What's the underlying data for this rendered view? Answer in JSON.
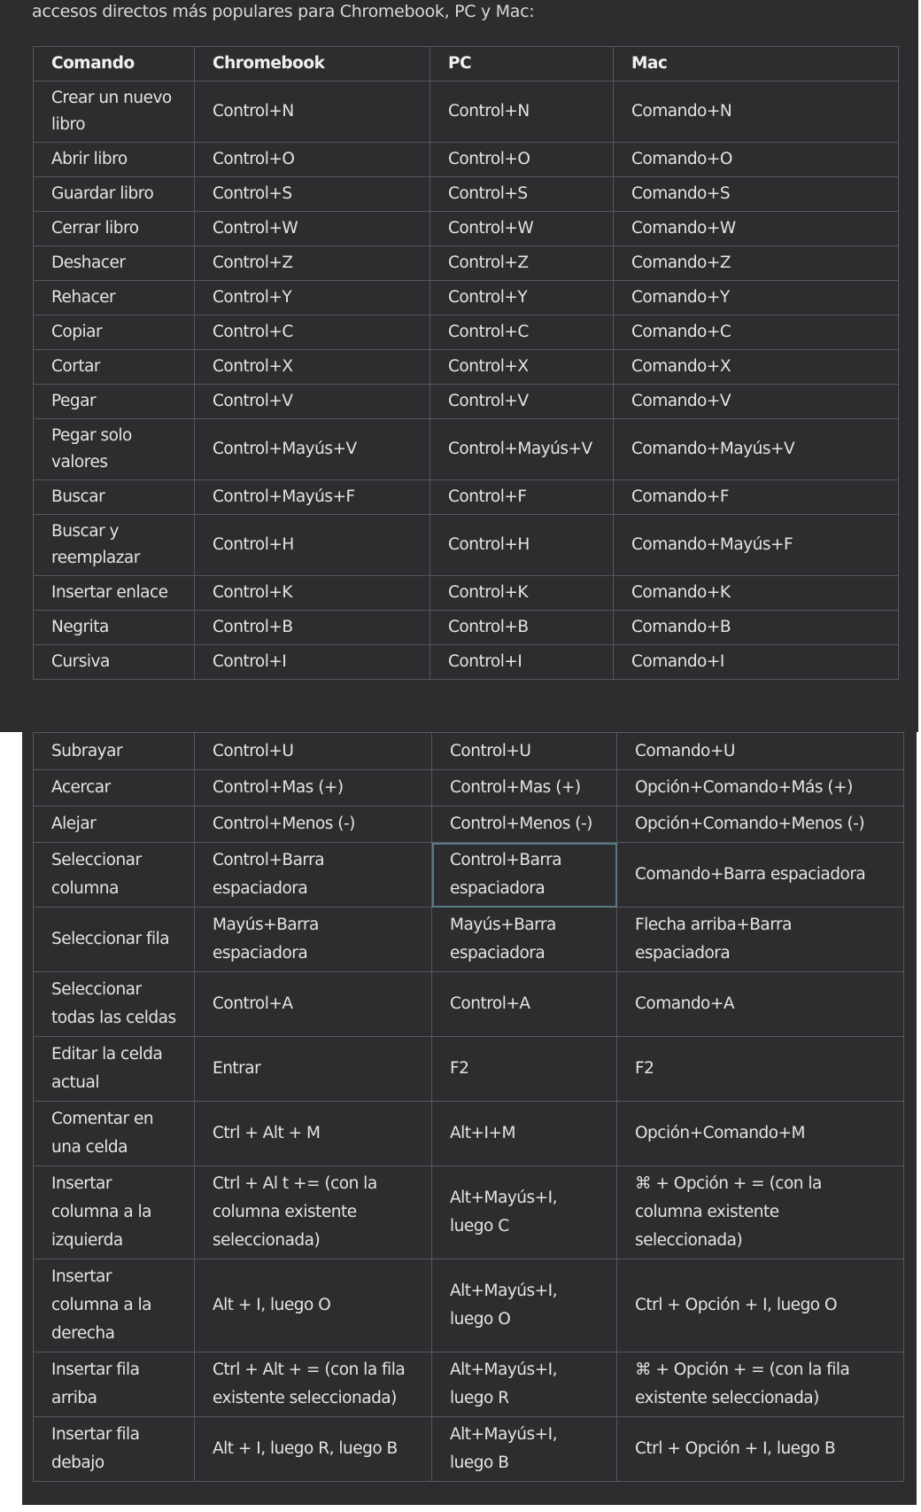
{
  "intro_text": "accesos directos más populares para Chromebook, PC y Mac:",
  "columns": [
    "Comando",
    "Chromebook",
    "PC",
    "Mac"
  ],
  "rows_top": [
    [
      "Crear un nuevo libro",
      "Control+N",
      "Control+N",
      "Comando+N"
    ],
    [
      "Abrir libro",
      "Control+O",
      "Control+O",
      "Comando+O"
    ],
    [
      "Guardar libro",
      "Control+S",
      "Control+S",
      "Comando+S"
    ],
    [
      "Cerrar libro",
      "Control+W",
      "Control+W",
      "Comando+W"
    ],
    [
      "Deshacer",
      "Control+Z",
      "Control+Z",
      "Comando+Z"
    ],
    [
      "Rehacer",
      "Control+Y",
      "Control+Y",
      "Comando+Y"
    ],
    [
      "Copiar",
      "Control+C",
      "Control+C",
      "Comando+C"
    ],
    [
      "Cortar",
      "Control+X",
      "Control+X",
      "Comando+X"
    ],
    [
      "Pegar",
      "Control+V",
      "Control+V",
      "Comando+V"
    ],
    [
      "Pegar solo valores",
      "Control+Mayús+V",
      "Control+Mayús+V",
      "Comando+Mayús+V"
    ],
    [
      "Buscar",
      "Control+Mayús+F",
      "Control+F",
      "Comando+F"
    ],
    [
      "Buscar y reemplazar",
      "Control+H",
      "Control+H",
      "Comando+Mayús+F"
    ],
    [
      "Insertar enlace",
      "Control+K",
      "Control+K",
      "Comando+K"
    ],
    [
      "Negrita",
      "Control+B",
      "Control+B",
      "Comando+B"
    ],
    [
      "Cursiva",
      "Control+I",
      "Control+I",
      "Comando+I"
    ]
  ],
  "rows_bottom": [
    [
      "Subrayar",
      "Control+U",
      "Control+U",
      "Comando+U"
    ],
    [
      "Acercar",
      "Control+Mas (+)",
      "Control+Mas (+)",
      "Opción+Comando+Más (+)"
    ],
    [
      "Alejar",
      "Control+Menos (-)",
      "Control+Menos (-)",
      "Opción+Comando+Menos (-)"
    ],
    [
      "Seleccionar columna",
      "Control+Barra espaciadora",
      "Control+Barra espaciadora",
      "Comando+Barra espaciadora"
    ],
    [
      "Seleccionar fila",
      "Mayús+Barra espaciadora",
      "Mayús+Barra espaciadora",
      "Flecha arriba+Barra espaciadora"
    ],
    [
      "Seleccionar todas las celdas",
      "Control+A",
      "Control+A",
      "Comando+A"
    ],
    [
      "Editar la celda actual",
      "Entrar",
      "F2",
      "F2"
    ],
    [
      "Comentar en una celda",
      "Ctrl + Alt + M",
      "Alt+I+M",
      "Opción+Comando+M"
    ],
    [
      "Insertar columna a la izquierda",
      "Ctrl + Al t += (con la columna existente seleccionada)",
      "Alt+Mayús+I, luego C",
      "⌘ + Opción + = (con la columna existente seleccionada)"
    ],
    [
      "Insertar columna a la derecha",
      "Alt + I, luego O",
      "Alt+Mayús+I, luego O",
      "Ctrl + Opción + I, luego O"
    ],
    [
      "Insertar fila arriba",
      "Ctrl + Alt + = (con la fila existente seleccionada)",
      "Alt+Mayús+I, luego R",
      "⌘ + Opción + = (con la fila existente seleccionada)"
    ],
    [
      "Insertar fila debajo",
      "Alt + I, luego R, luego B",
      "Alt+Mayús+I, luego B",
      "Ctrl + Opción + I, luego B"
    ]
  ],
  "colors": {
    "background": "#2d2d2f",
    "border": "#55575b",
    "text": "#e4e4e4",
    "focus_border": "#5a7b86"
  }
}
